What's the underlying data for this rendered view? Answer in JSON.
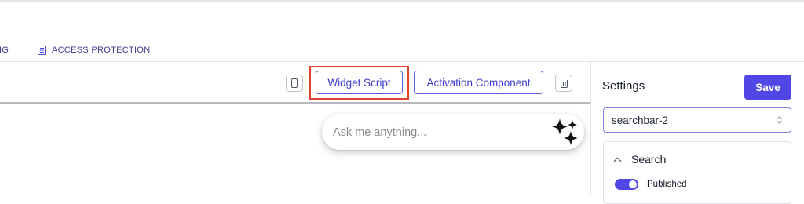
{
  "tabs": [
    {
      "label": "FIG"
    },
    {
      "label": "ACCESS PROTECTION",
      "icon": "document-icon"
    }
  ],
  "toolbar": {
    "mobile_preview_icon": "mobile-phone-icon",
    "widget_script_label": "Widget Script",
    "activation_component_label": "Activation Component",
    "delete_icon": "trash-icon"
  },
  "preview": {
    "search_placeholder": "Ask me anything...",
    "sparkle_icon": "sparkles-icon"
  },
  "settings": {
    "title": "Settings",
    "save_label": "Save",
    "selected_widget": "searchbar-2",
    "section": {
      "title": "Search",
      "published_label": "Published",
      "published": true
    }
  },
  "colors": {
    "accent": "#4f46e5",
    "highlight": "#e0442e"
  }
}
